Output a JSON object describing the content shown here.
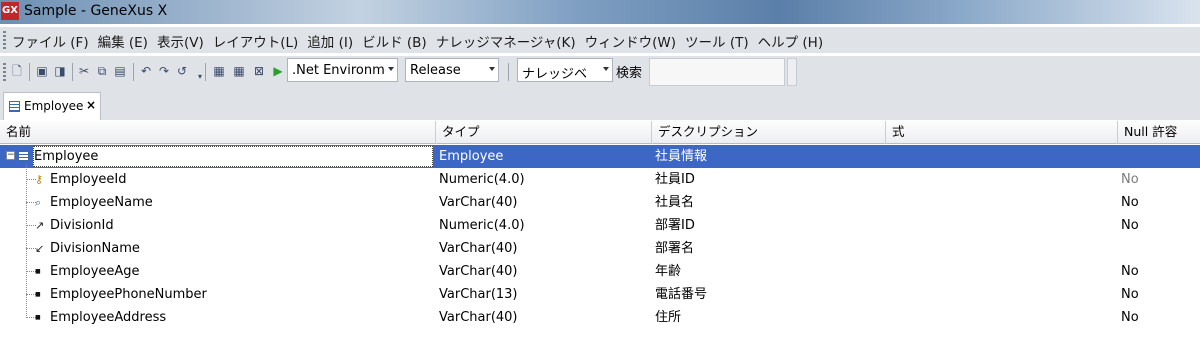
{
  "window": {
    "title": "Sample - GeneXus X",
    "logo_text": "GX"
  },
  "menu": {
    "items": [
      "ファイル (F)",
      "編集 (E)",
      "表示(V)",
      "レイアウト(L)",
      "追加 (I)",
      "ビルド (B)",
      "ナレッジマネージャ(K)",
      "ウィンドウ(W)",
      "ツール (T)",
      "ヘルプ (H)"
    ]
  },
  "toolbar": {
    "environment": ".Net Environm",
    "configuration": "Release",
    "knowledge_base": "ナレッジベ",
    "search_label": "検索",
    "search_value": ""
  },
  "tab": {
    "label": "Employee",
    "close": "×"
  },
  "grid": {
    "headers": {
      "name": "名前",
      "type": "タイプ",
      "description": "デスクリプション",
      "formula": "式",
      "nullable": "Null 許容"
    },
    "root": {
      "name": "Employee",
      "type": "Employee",
      "description": "社員情報",
      "expander": "−"
    },
    "rows": [
      {
        "name": "EmployeeId",
        "type": "Numeric(4.0)",
        "description": "社員ID",
        "formula": "",
        "nullable": "No",
        "nullable_muted": true,
        "icon": "key-icon"
      },
      {
        "name": "EmployeeName",
        "type": "VarChar(40)",
        "description": "社員名",
        "formula": "",
        "nullable": "No",
        "nullable_muted": false,
        "icon": "description-key-icon"
      },
      {
        "name": "DivisionId",
        "type": "Numeric(4.0)",
        "description": "部署ID",
        "formula": "",
        "nullable": "No",
        "nullable_muted": false,
        "icon": "foreign-key-icon"
      },
      {
        "name": "DivisionName",
        "type": "VarChar(40)",
        "description": "部署名",
        "formula": "",
        "nullable": "",
        "nullable_muted": false,
        "icon": "inferred-attribute-icon"
      },
      {
        "name": "EmployeeAge",
        "type": "VarChar(40)",
        "description": "年齢",
        "formula": "",
        "nullable": "No",
        "nullable_muted": false,
        "icon": "attribute-icon"
      },
      {
        "name": "EmployeePhoneNumber",
        "type": "VarChar(13)",
        "description": "電話番号",
        "formula": "",
        "nullable": "No",
        "nullable_muted": false,
        "icon": "attribute-icon"
      },
      {
        "name": "EmployeeAddress",
        "type": "VarChar(40)",
        "description": "住所",
        "formula": "",
        "nullable": "No",
        "nullable_muted": false,
        "icon": "attribute-icon"
      }
    ]
  },
  "colors": {
    "selection": "#3c67c4",
    "chrome": "#dfe3e8",
    "logo": "#c0272d"
  }
}
